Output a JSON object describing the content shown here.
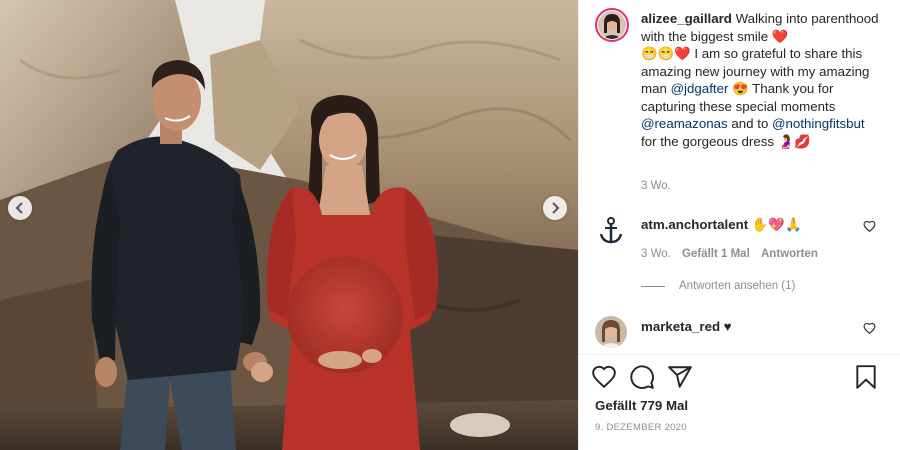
{
  "post": {
    "username": "alizee_gaillard",
    "caption_parts": {
      "p1": " Walking into parenthood with the biggest smile ",
      "p2": " I am so grateful to share this amazing new journey with my amazing man ",
      "mention1": "@jdgafter",
      "p3": " Thank you for capturing these special moments ",
      "mention2": "@reamazonas",
      "p4": " and to ",
      "mention3": "@nothingfitsbut",
      "p5": " for the gorgeous dress "
    },
    "caption_time": "3 Wo."
  },
  "comments": [
    {
      "username": "atm.anchortalent",
      "emojis": "✋💖🙏",
      "time": "3 Wo.",
      "likes": "Gefällt 1 Mal",
      "reply": "Antworten",
      "view_replies": "Antworten ansehen (1)"
    },
    {
      "username": "marketa_red",
      "text": "♥"
    }
  ],
  "likes_label": "Gefällt 779 Mal",
  "date": "9. DEZEMBER 2020",
  "icons": {
    "like": "heart-icon",
    "comment": "comment-icon",
    "share": "share-icon",
    "save": "bookmark-icon",
    "prev": "chevron-left-icon",
    "next": "chevron-right-icon"
  },
  "colors": {
    "accent_link": "#00376b",
    "muted": "#8e8e8e",
    "heart": "#ed4956",
    "dress": "#b8322a"
  }
}
